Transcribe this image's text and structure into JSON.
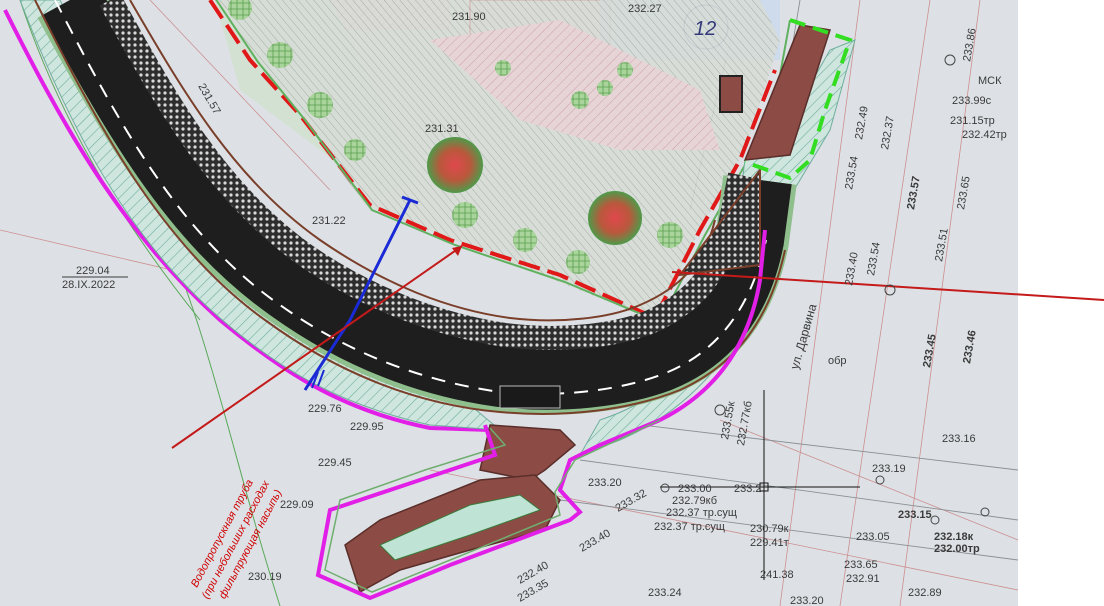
{
  "canvas": {
    "background": "#dde1e5",
    "right_margin": "#ffffff"
  },
  "colors": {
    "road_asphalt": "#2a2a2a",
    "cobble": "#4a4a4a",
    "verge": "#a8c9a4",
    "hatch_cyan": "#9fd6cf",
    "boundary_magenta": "#e11fe6",
    "boundary_red": "#e01818",
    "pipe_blue": "#1a2bd6",
    "brown_paving": "#8c4b45",
    "green_dashed": "#33dd22",
    "pink_zone": "#f4c9d2"
  },
  "labels": {
    "l1": "231.90",
    "l2": "232.27",
    "l3": "12",
    "l4": "231.57",
    "l5": "231.31",
    "l6": "231.22",
    "l7": "229.04",
    "l8": "28.IX.2022",
    "l9": "229.76",
    "l10": "229.95",
    "l11": "229.45",
    "l12": "229.09",
    "l13": "230.19",
    "l14": "233.20",
    "l15": "233.32",
    "l16": "233.00",
    "l17": "232.79кб",
    "l18": "232.37 тр.сущ",
    "l19": "232.37 тр.сущ",
    "l20": "230.79к",
    "l21": "229.41т",
    "l22": "241.38",
    "l23": "233.40",
    "l24": "232.40",
    "l25": "233.35",
    "l26": "233.24",
    "l27": "233.20",
    "l28": "233.99с",
    "l29": "231.15тр",
    "l30": "232.42тр",
    "l31": "232.49",
    "l32": "232.37",
    "l33": "233.54",
    "l34": "233.57",
    "l35": "233.65",
    "l36": "233.16",
    "l37": "233.19",
    "l38": "233.15",
    "l39": "232.18к",
    "l40": "232.00тр",
    "l41": "233.05",
    "l42": "233.65",
    "l43": "232.91",
    "l44": "232.89",
    "l45": "ул. Дарвина",
    "l46": "обр",
    "l47": "233.45",
    "l48": "233.46",
    "l49": "233.55к",
    "l50": "232.77кб",
    "l51": "233.86",
    "l52": "МСК",
    "l53": "233.40",
    "l54": "233.54",
    "l55": "233.2",
    "l56": "233.51"
  },
  "annotation": {
    "line1": "Водопропускная труба",
    "line2": "(при небольших расходах",
    "line3": "фильтрующая насыпь)"
  }
}
